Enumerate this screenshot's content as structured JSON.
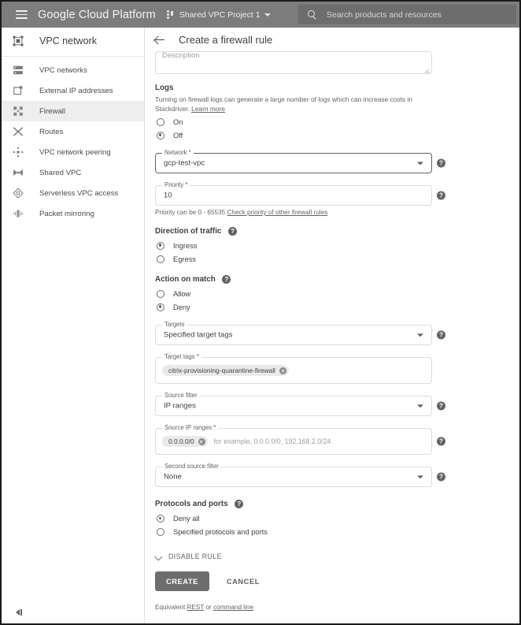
{
  "topbar": {
    "menu_icon": "hamburger-icon",
    "brand": "Google Cloud Platform",
    "project_icon": "project-icon",
    "project": "Shared VPC Project 1",
    "project_caret": "chevron-down-icon",
    "search_icon": "search-icon",
    "search_placeholder": "Search products and resources",
    "search_value": ""
  },
  "sidebar": {
    "title": "VPC network",
    "title_icon": "vpc-network-icon",
    "collapse_icon": "collapse-sidebar-icon",
    "items": [
      {
        "label": "VPC networks",
        "icon": "vpc-networks-icon",
        "active": false
      },
      {
        "label": "External IP addresses",
        "icon": "external-ip-icon",
        "active": false
      },
      {
        "label": "Firewall",
        "icon": "firewall-icon",
        "active": true
      },
      {
        "label": "Routes",
        "icon": "routes-icon",
        "active": false
      },
      {
        "label": "VPC network peering",
        "icon": "network-peering-icon",
        "active": false
      },
      {
        "label": "Shared VPC",
        "icon": "shared-vpc-icon",
        "active": false
      },
      {
        "label": "Serverless VPC access",
        "icon": "serverless-vpc-icon",
        "active": false
      },
      {
        "label": "Packet mirroring",
        "icon": "packet-mirroring-icon",
        "active": false
      }
    ]
  },
  "page": {
    "back_icon": "back-arrow-icon",
    "title": "Create a firewall rule"
  },
  "form": {
    "description": {
      "placeholder": "Description",
      "value": ""
    },
    "logs": {
      "heading": "Logs",
      "help_text": "Turning on firewall logs can generate a large number of logs which can increase costs in Stackdriver.",
      "help_link": "Learn more",
      "options": [
        {
          "label": "On",
          "selected": false
        },
        {
          "label": "Off",
          "selected": true
        }
      ]
    },
    "network": {
      "label": "Network *",
      "value": "gcp-test-vpc",
      "focused": true,
      "help_icon": "help-icon"
    },
    "priority": {
      "label": "Priority *",
      "value": "10",
      "help_icon": "help-icon",
      "hint_prefix": "Priority can be 0 - 65535 ",
      "hint_link": "Check priority of other firewall rules"
    },
    "direction": {
      "heading": "Direction of traffic",
      "help_icon": "help-icon",
      "options": [
        {
          "label": "Ingress",
          "selected": true
        },
        {
          "label": "Egress",
          "selected": false
        }
      ]
    },
    "action": {
      "heading": "Action on match",
      "help_icon": "help-icon",
      "options": [
        {
          "label": "Allow",
          "selected": false
        },
        {
          "label": "Deny",
          "selected": true
        }
      ]
    },
    "targets": {
      "label": "Targets",
      "value": "Specified target tags",
      "help_icon": "help-icon"
    },
    "target_tags": {
      "label": "Target tags *",
      "chips": [
        "citrix-provisioning-quarantine-firewall"
      ]
    },
    "source_filter": {
      "label": "Source filter",
      "value": "IP ranges",
      "help_icon": "help-icon"
    },
    "source_ip_ranges": {
      "label": "Source IP ranges *",
      "chips": [
        "0.0.0.0/0"
      ],
      "placeholder": "for example, 0.0.0.0/0, 192.168.2.0/24",
      "help_icon": "help-icon"
    },
    "second_source_filter": {
      "label": "Second source filter",
      "value": "None",
      "help_icon": "help-icon"
    },
    "protocols": {
      "heading": "Protocols and ports",
      "help_icon": "help-icon",
      "options": [
        {
          "label": "Deny all",
          "selected": true
        },
        {
          "label": "Specified protocols and ports",
          "selected": false
        }
      ]
    },
    "disable_rule": {
      "label": "DISABLE RULE",
      "icon": "chevron-down-icon"
    },
    "create_label": "CREATE",
    "cancel_label": "CANCEL",
    "equivalent": {
      "prefix": "Equivalent ",
      "rest": "REST",
      "middle": " or ",
      "cmdline": "command line"
    }
  },
  "colors": {
    "topbar": "#7c7c7c",
    "accent_button": "#6d6d6d",
    "active_item": "#eeeeee",
    "border": "#dadce0",
    "text": "#3c4043",
    "muted": "#5f6368"
  }
}
